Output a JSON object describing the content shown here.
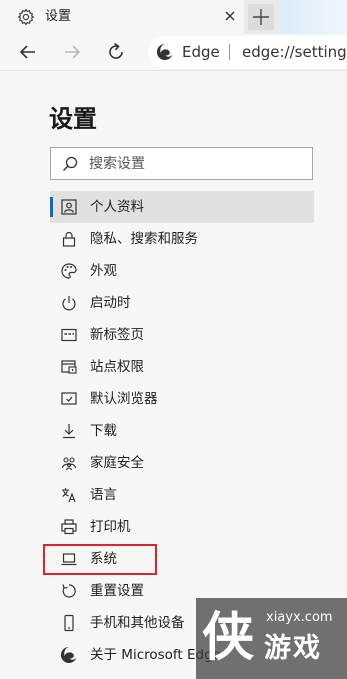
{
  "tab": {
    "title": "设置",
    "new_tab_symbol": "+"
  },
  "address_bar": {
    "site_label": "Edge",
    "url": "edge://settings"
  },
  "page": {
    "title": "设置"
  },
  "search": {
    "placeholder": "搜索设置"
  },
  "accent_color": "#0f6cbd",
  "highlight_color": "#e0242a",
  "nav_items": [
    {
      "label": "个人资料",
      "icon": "profile-icon",
      "selected": true
    },
    {
      "label": "隐私、搜索和服务",
      "icon": "lock-icon"
    },
    {
      "label": "外观",
      "icon": "palette-icon"
    },
    {
      "label": "启动时",
      "icon": "power-icon"
    },
    {
      "label": "新标签页",
      "icon": "new-tab-page-icon"
    },
    {
      "label": "站点权限",
      "icon": "site-permissions-icon"
    },
    {
      "label": "默认浏览器",
      "icon": "default-browser-icon"
    },
    {
      "label": "下载",
      "icon": "download-icon"
    },
    {
      "label": "家庭安全",
      "icon": "family-icon"
    },
    {
      "label": "语言",
      "icon": "language-icon"
    },
    {
      "label": "打印机",
      "icon": "printer-icon"
    },
    {
      "label": "系统",
      "icon": "laptop-icon",
      "highlighted": true
    },
    {
      "label": "重置设置",
      "icon": "reset-icon"
    },
    {
      "label": "手机和其他设备",
      "icon": "phone-icon"
    },
    {
      "label": "关于 Microsoft Edge",
      "icon": "edge-icon"
    }
  ],
  "watermark": {
    "glyph": "侠",
    "site": "xiayx.com",
    "name": "游戏"
  }
}
